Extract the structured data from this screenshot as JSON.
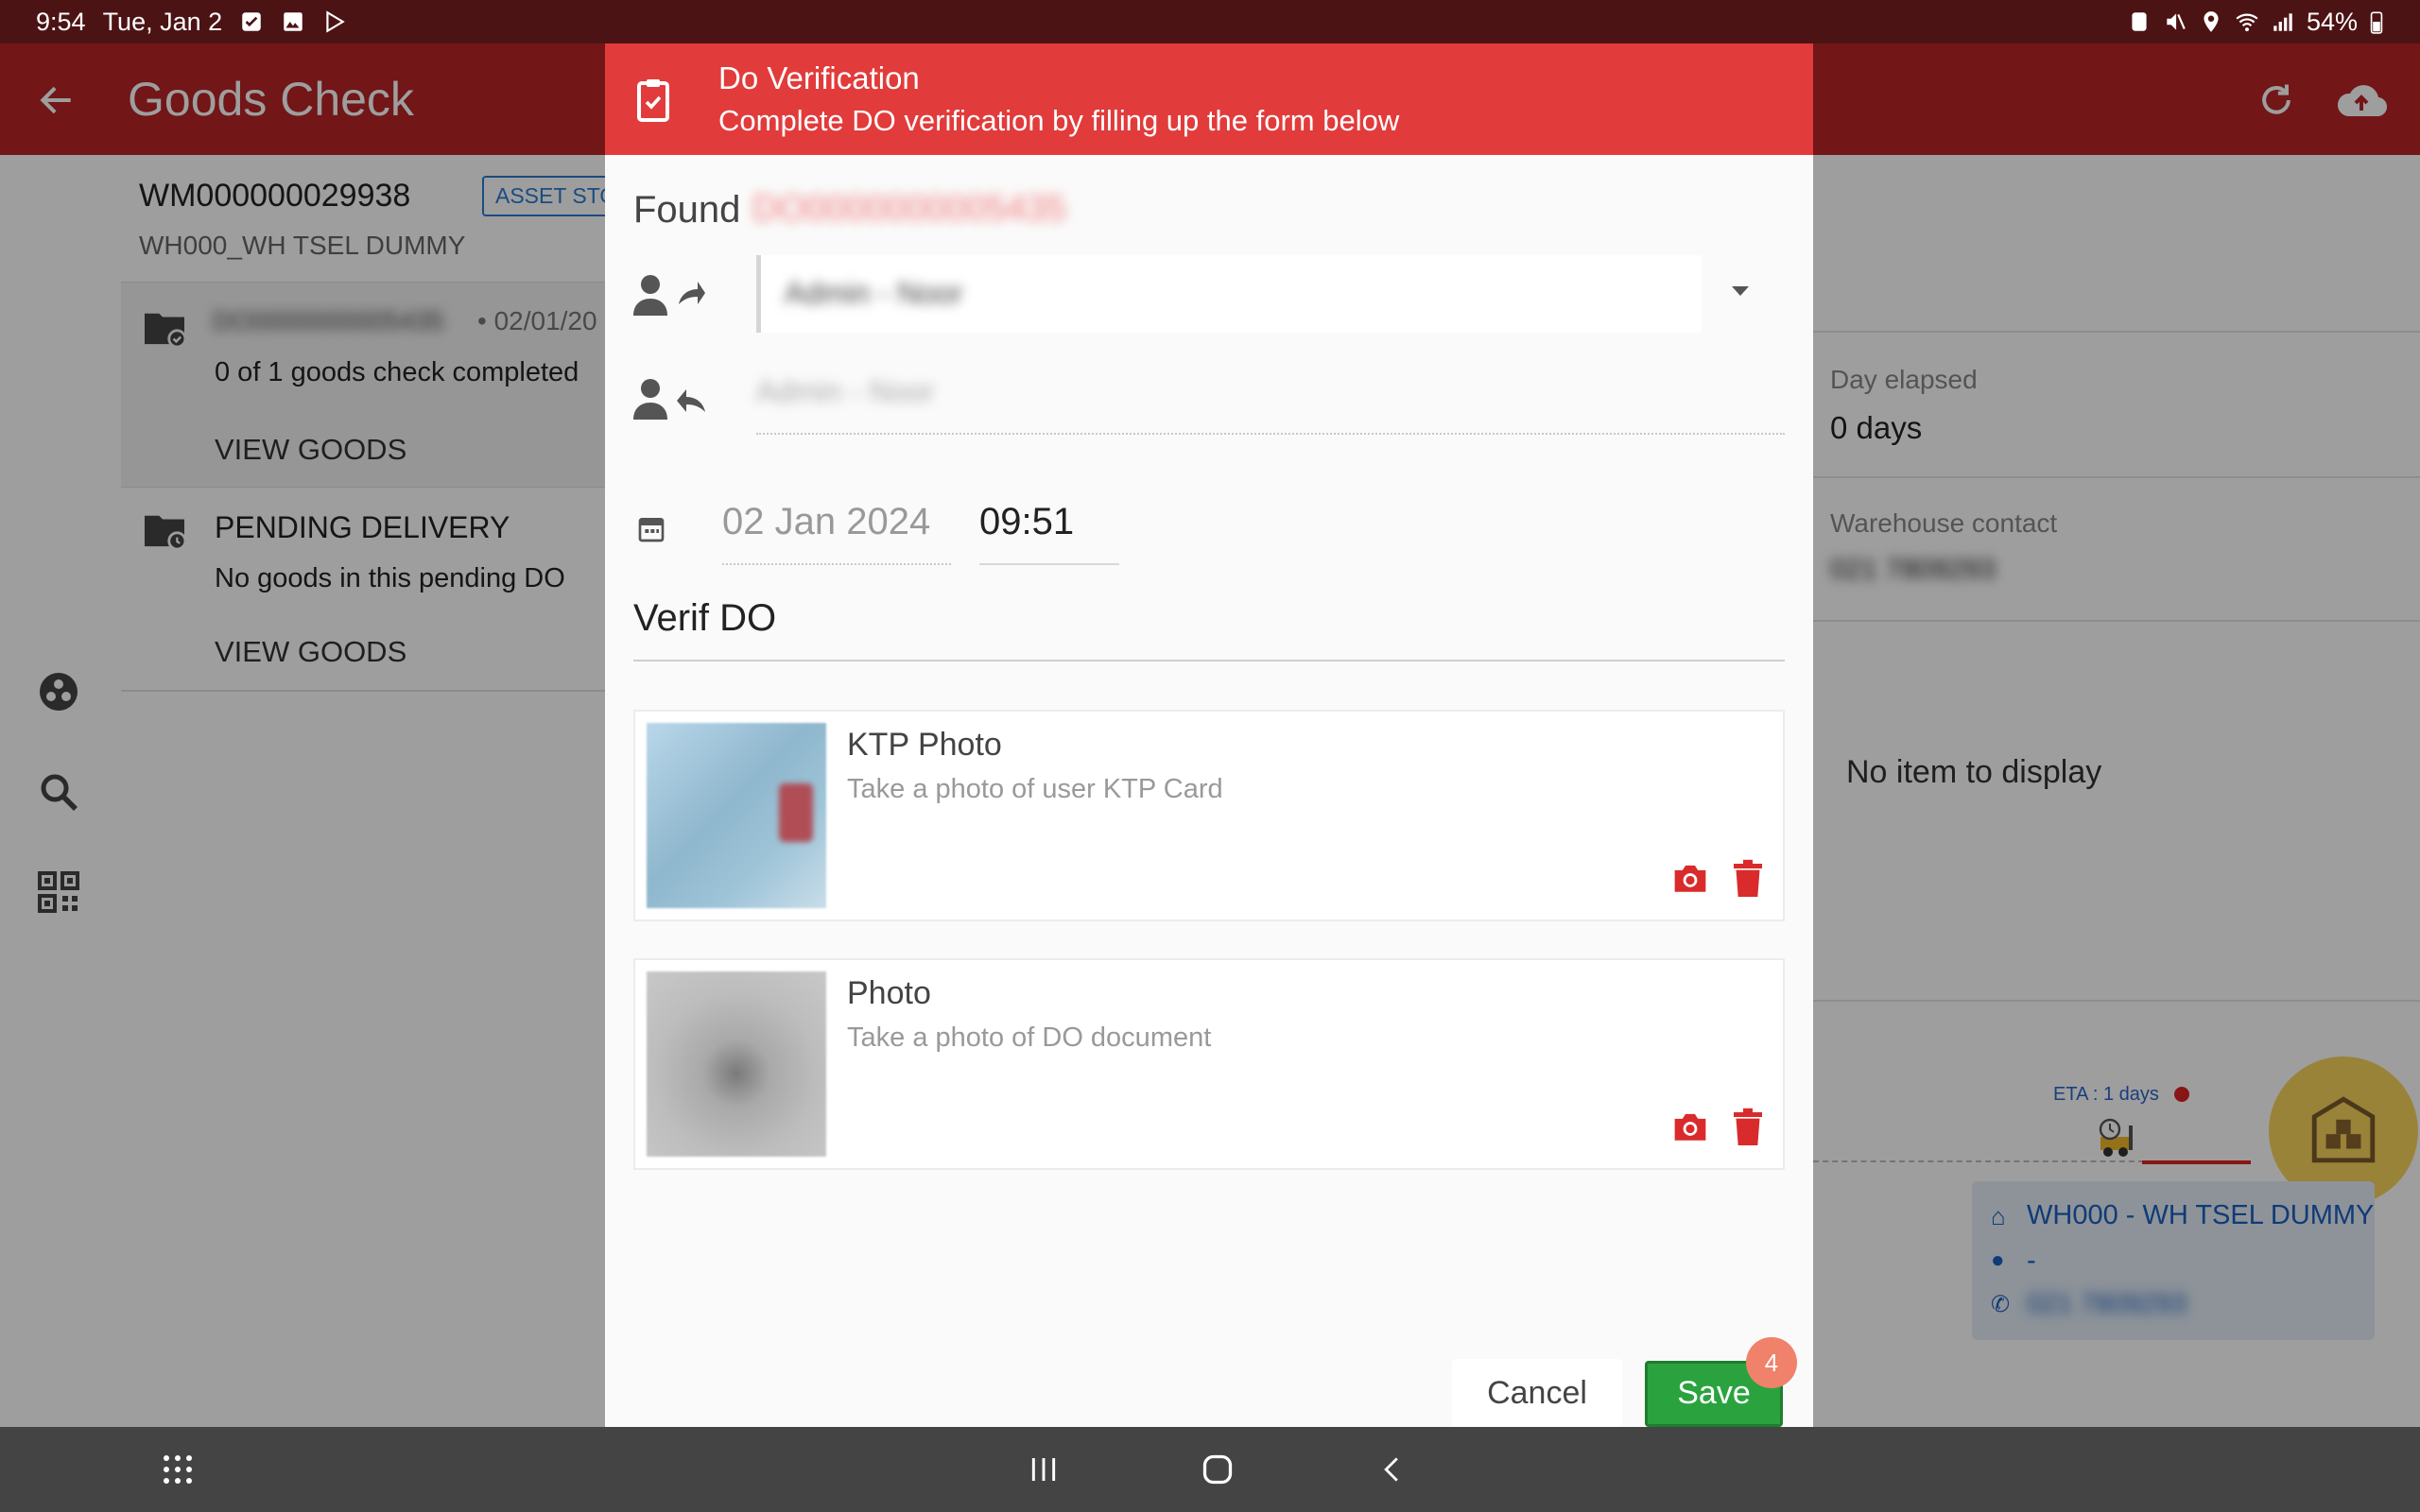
{
  "status_bar": {
    "time": "9:54",
    "date": "Tue, Jan 2",
    "battery": "54%"
  },
  "app_bar": {
    "title": "Goods Check"
  },
  "shipment": {
    "id": "WM000000029938",
    "badge": "ASSET STO",
    "warehouse": "WH000_WH TSEL DUMMY"
  },
  "do_card": {
    "do_number": "DO0000000005435",
    "date": "• 02/01/20",
    "progress": "0 of  1 goods check completed",
    "view_goods": "VIEW GOODS"
  },
  "pending_card": {
    "title": "PENDING DELIVERY",
    "subtitle": "No goods in this pending DO",
    "view_goods": "VIEW GOODS"
  },
  "right_panel": {
    "day_elapsed_label": "Day elapsed",
    "day_elapsed_value": "0 days",
    "contact_label": "Warehouse contact",
    "contact_value": "021 7809293",
    "no_item": "No item to display",
    "eta": "ETA : 1 days",
    "warehouse_title": "WH000 - WH TSEL DUMMY",
    "warehouse_person": "-",
    "warehouse_phone": "021 7809293"
  },
  "dialog": {
    "title": "Do Verification",
    "subtitle": "Complete DO verification by filling up the form below",
    "found_label": "Found",
    "found_value": "DO0000000005435",
    "sender_value": "Admin - Noor",
    "receiver_value": "Admin - Noor",
    "date": "02 Jan 2024",
    "time": "09:51",
    "section_title": "Verif DO",
    "photos": [
      {
        "title": "KTP Photo",
        "subtitle": "Take a photo of user KTP Card"
      },
      {
        "title": "Photo",
        "subtitle": "Take a photo of DO document"
      }
    ],
    "cancel_label": "Cancel",
    "save_label": "Save",
    "save_badge": "4"
  },
  "colors": {
    "status_bar": "#4c1315",
    "app_bar": "#b82427",
    "dialog_header": "#e23b3b",
    "save_button": "#2aa33f",
    "icon_red": "#d92b2b"
  },
  "icons": [
    "back-arrow-icon",
    "refresh-icon",
    "cloud-upload-icon",
    "clipboard-check-icon",
    "person-forward-icon",
    "person-reply-icon",
    "calendar-icon",
    "camera-icon",
    "trash-icon",
    "folder-icon",
    "search-icon",
    "qr-code-icon",
    "group-icon"
  ]
}
